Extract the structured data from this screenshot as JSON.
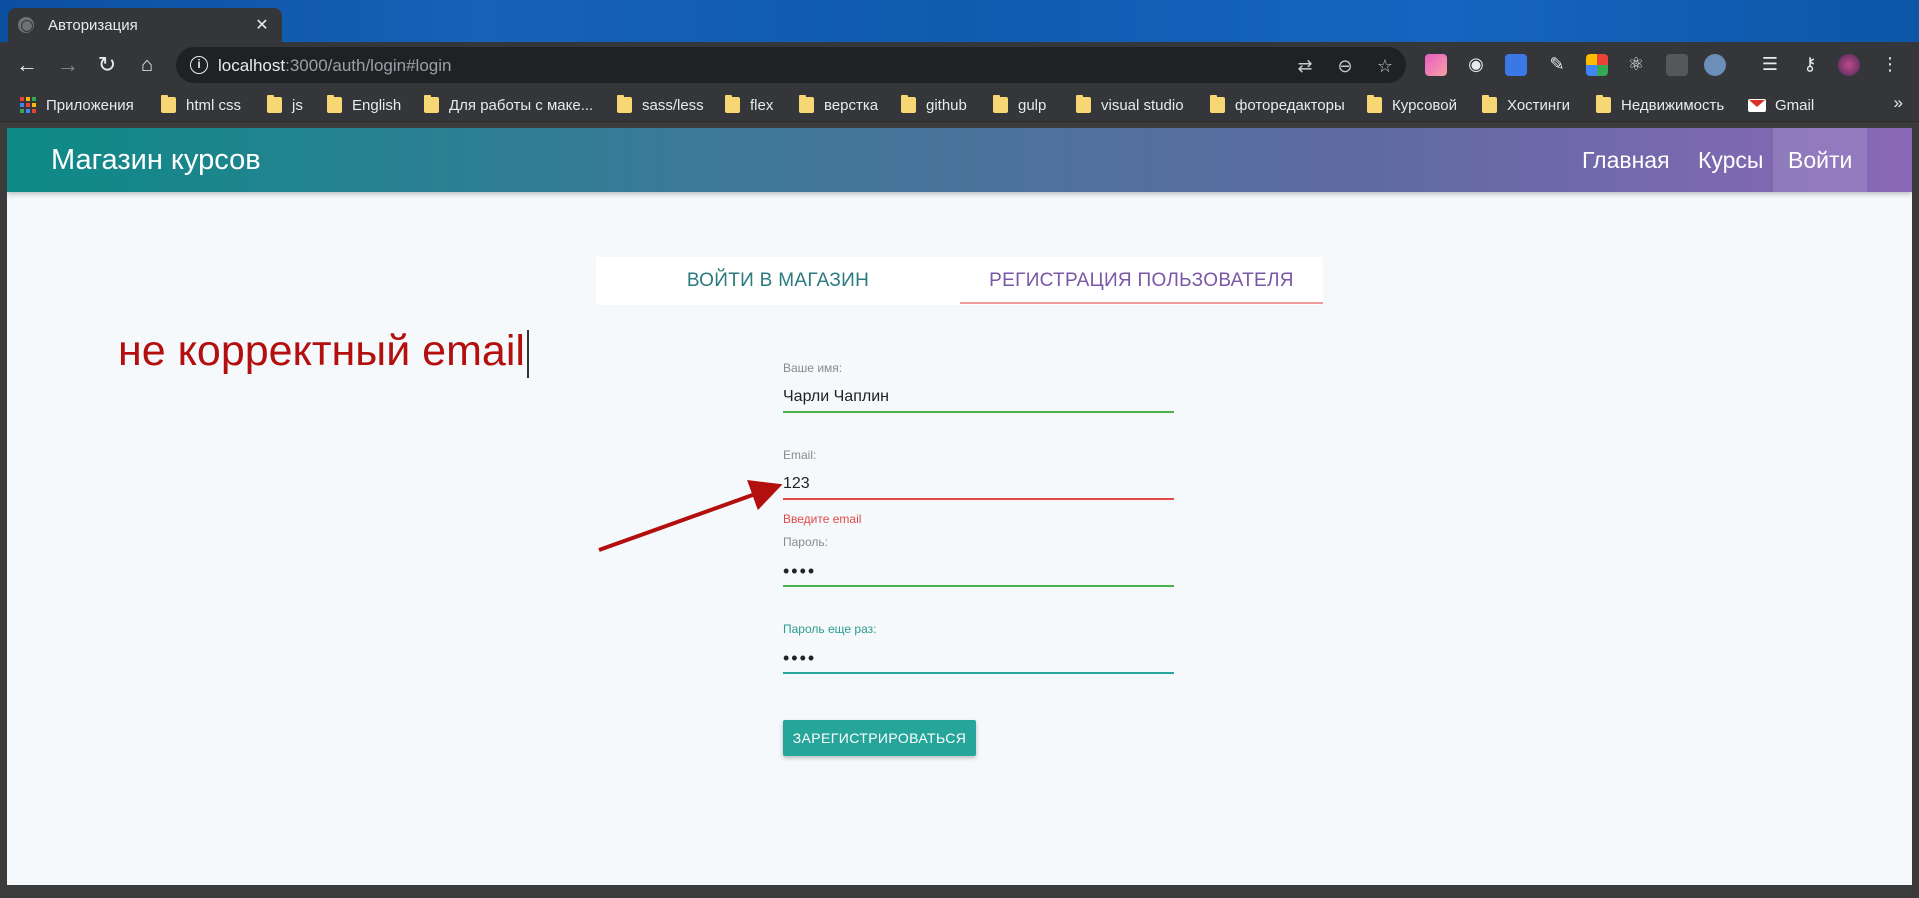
{
  "browser": {
    "tab_title": "Авторизация",
    "url_host": "localhost",
    "url_path": ":3000/auth/login#login",
    "bookmarks": [
      {
        "label": "Приложения",
        "icon": "apps-grid-icon"
      },
      {
        "label": "html css",
        "icon": "folder-icon"
      },
      {
        "label": "js",
        "icon": "folder-icon"
      },
      {
        "label": "English",
        "icon": "folder-icon"
      },
      {
        "label": "Для работы с маке...",
        "icon": "folder-icon"
      },
      {
        "label": "sass/less",
        "icon": "folder-icon"
      },
      {
        "label": "flex",
        "icon": "folder-icon"
      },
      {
        "label": "верстка",
        "icon": "folder-icon"
      },
      {
        "label": "github",
        "icon": "folder-icon"
      },
      {
        "label": "gulp",
        "icon": "folder-icon"
      },
      {
        "label": "visual studio",
        "icon": "folder-icon"
      },
      {
        "label": "фоторедакторы",
        "icon": "folder-icon"
      },
      {
        "label": "Курсовой",
        "icon": "folder-icon"
      },
      {
        "label": "Хостинги",
        "icon": "folder-icon"
      },
      {
        "label": "Недвижимость",
        "icon": "folder-icon"
      },
      {
        "label": "Gmail",
        "icon": "gmail-icon"
      }
    ],
    "more_bookmarks": "»"
  },
  "site": {
    "brand": "Магазин курсов",
    "nav": [
      {
        "label": "Главная",
        "active": false
      },
      {
        "label": "Курсы",
        "active": false
      },
      {
        "label": "Войти",
        "active": true
      }
    ]
  },
  "auth_tabs": {
    "login": "ВОЙТИ В МАГАЗИН",
    "register": "РЕГИСТРАЦИЯ ПОЛЬЗОВАТЕЛЯ",
    "active": "register"
  },
  "form": {
    "name": {
      "label": "Ваше имя:",
      "value": "Чарли Чаплин"
    },
    "email": {
      "label": "Email:",
      "value": "123",
      "error": "Введите email"
    },
    "password": {
      "label": "Пароль:",
      "value": "••••"
    },
    "password_repeat": {
      "label": "Пароль еще раз:",
      "value": "••••"
    },
    "submit": "ЗАРЕГИСТРИРОВАТЬСЯ"
  },
  "annotation": {
    "text": "не корректный email",
    "color": "#b30f0f"
  },
  "colors": {
    "accent": "#26a69a",
    "error": "#e04a4a",
    "valid": "#4caf50",
    "register_tab": "#7a56a6"
  }
}
